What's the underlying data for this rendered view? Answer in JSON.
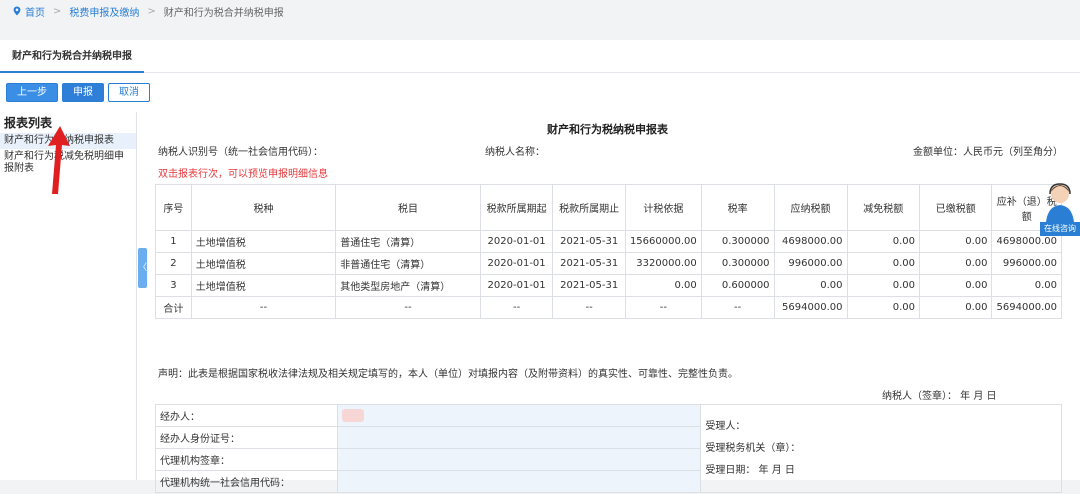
{
  "breadcrumb": {
    "home": "首页",
    "level1": "税费申报及缴纳",
    "current": "财产和行为税合并纳税申报"
  },
  "tab": {
    "label": "财产和行为税合并纳税申报"
  },
  "toolbar": {
    "prev": "上一步",
    "submit": "申报",
    "cancel": "取消"
  },
  "sidebar": {
    "title": "报表列表",
    "items": [
      "财产和行为税纳税申报表",
      "财产和行为税减免税明细申报附表"
    ]
  },
  "form": {
    "title": "财产和行为税纳税申报表",
    "taxpayer_id_label": "纳税人识别号（统一社会信用代码）：",
    "taxpayer_name_label": "纳税人名称：",
    "unit_label": "金额单位：人民币元（列至角分）",
    "hint": "双击报表行次，可以预览申报明细信息",
    "headers": [
      "序号",
      "税种",
      "税目",
      "税款所属期起",
      "税款所属期止",
      "计税依据",
      "税率",
      "应纳税额",
      "减免税额",
      "已缴税额",
      "应补（退）税额"
    ],
    "rows": [
      [
        "1",
        "土地增值税",
        "普通住宅（清算）",
        "2020-01-01",
        "2021-05-31",
        "15660000.00",
        "0.300000",
        "4698000.00",
        "0.00",
        "0.00",
        "4698000.00"
      ],
      [
        "2",
        "土地增值税",
        "非普通住宅（清算）",
        "2020-01-01",
        "2021-05-31",
        "3320000.00",
        "0.300000",
        "996000.00",
        "0.00",
        "0.00",
        "996000.00"
      ],
      [
        "3",
        "土地增值税",
        "其他类型房地产（清算）",
        "2020-01-01",
        "2021-05-31",
        "0.00",
        "0.600000",
        "0.00",
        "0.00",
        "0.00",
        "0.00"
      ]
    ],
    "total_row": [
      "合计",
      "--",
      "--",
      "--",
      "--",
      "--",
      "--",
      "5694000.00",
      "0.00",
      "0.00",
      "5694000.00"
    ],
    "declaration": "声明：此表是根据国家税收法律法规及相关规定填写的，本人（单位）对填报内容（及附带资料）的真实性、可靠性、完整性负责。",
    "signature": "纳税人（签章）：        年    月    日",
    "agent_label": "经办人：",
    "agent_id_label": "经办人身份证号：",
    "agency_sign_label": "代理机构签章：",
    "agency_code_label": "代理机构统一社会信用代码：",
    "receiver_label": "受理人：",
    "tax_office_label": "受理税务机关（章）：",
    "receive_date_label": "受理日期：      年    月    日"
  },
  "consult": {
    "label": "在线咨询"
  },
  "colors": {
    "accent": "#2a7fd4",
    "hint": "#e4393c",
    "arrow": "#e02020"
  }
}
